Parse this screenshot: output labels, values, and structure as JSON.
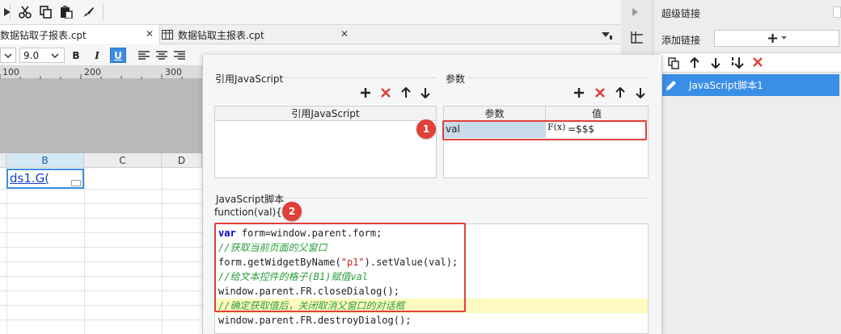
{
  "tabs": [
    {
      "label": "数据钻取子报表.cpt",
      "close": "✕"
    },
    {
      "label": "数据钻取主报表.cpt",
      "close": "✕"
    }
  ],
  "format": {
    "font_size": "9.0",
    "bold": "B",
    "italic": "I",
    "underline": "U"
  },
  "ruler": [
    "100",
    "200",
    "300"
  ],
  "sheet": {
    "columns": [
      "B",
      "C",
      "D"
    ],
    "cell_b1": "ds1.G("
  },
  "right_panel": {
    "title": "超级链接",
    "add_label": "添加链接",
    "add_button": "+",
    "item": "JavaScript脚本1"
  },
  "dialog": {
    "ref_js_title": "引用JavaScript",
    "ref_js_col": "引用JavaScript",
    "params_title": "参数",
    "params_cols": [
      "参数",
      "值"
    ],
    "param_row": {
      "name": "val",
      "formula": "F(x)",
      "value": "=$$$"
    },
    "script_title": "JavaScript脚本",
    "func_sig": "function(val){",
    "code": [
      {
        "kw": "var",
        "rest": " form=window.parent.form;"
      },
      {
        "comment": "//获取当前页面的父窗口"
      },
      {
        "pre": "form.getWidgetByName(",
        "str": "\"p1\"",
        "post": ").setValue(val);"
      },
      {
        "comment": "//给文本控件的格子(B1)赋值val"
      },
      {
        "text": "window.parent.FR.closeDialog();"
      },
      {
        "comment": "//确定获取值后，关闭取消父窗口的对话框"
      },
      {
        "text": "window.parent.FR.destroyDialog();"
      }
    ]
  },
  "badges": [
    "1",
    "2"
  ],
  "colors": {
    "accent": "#3a8ee6",
    "annotation": "#e0403a",
    "keyword": "#0000c8",
    "comment": "#2a9d3a"
  }
}
